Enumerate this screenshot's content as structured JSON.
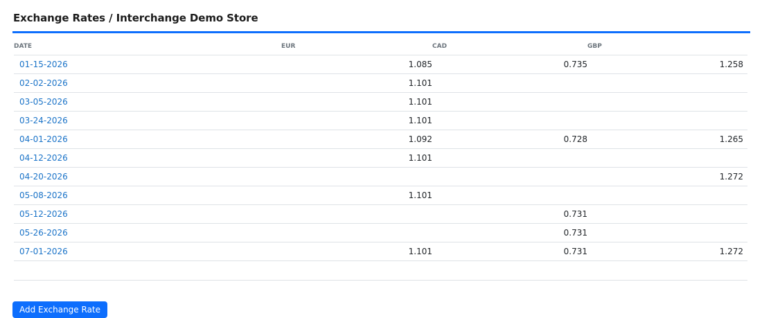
{
  "page": {
    "title": "Exchange Rates / Interchange Demo Store"
  },
  "table": {
    "columns": [
      "DATE",
      "EUR",
      "CAD",
      "GBP"
    ],
    "rows": [
      {
        "date": "01-15-2026",
        "eur": "1.085",
        "cad": "0.735",
        "gbp": "1.258"
      },
      {
        "date": "02-02-2026",
        "eur": "1.101",
        "cad": "",
        "gbp": ""
      },
      {
        "date": "03-05-2026",
        "eur": "1.101",
        "cad": "",
        "gbp": ""
      },
      {
        "date": "03-24-2026",
        "eur": "1.101",
        "cad": "",
        "gbp": ""
      },
      {
        "date": "04-01-2026",
        "eur": "1.092",
        "cad": "0.728",
        "gbp": "1.265"
      },
      {
        "date": "04-12-2026",
        "eur": "1.101",
        "cad": "",
        "gbp": ""
      },
      {
        "date": "04-20-2026",
        "eur": "",
        "cad": "",
        "gbp": "1.272"
      },
      {
        "date": "05-08-2026",
        "eur": "1.101",
        "cad": "",
        "gbp": ""
      },
      {
        "date": "05-12-2026",
        "eur": "",
        "cad": "0.731",
        "gbp": ""
      },
      {
        "date": "05-26-2026",
        "eur": "",
        "cad": "0.731",
        "gbp": ""
      },
      {
        "date": "07-01-2026",
        "eur": "1.101",
        "cad": "0.731",
        "gbp": "1.272"
      }
    ]
  },
  "actions": {
    "add_label": "Add Exchange Rate"
  },
  "colors": {
    "accent": "#0d6efd",
    "link": "#1a73c8"
  }
}
